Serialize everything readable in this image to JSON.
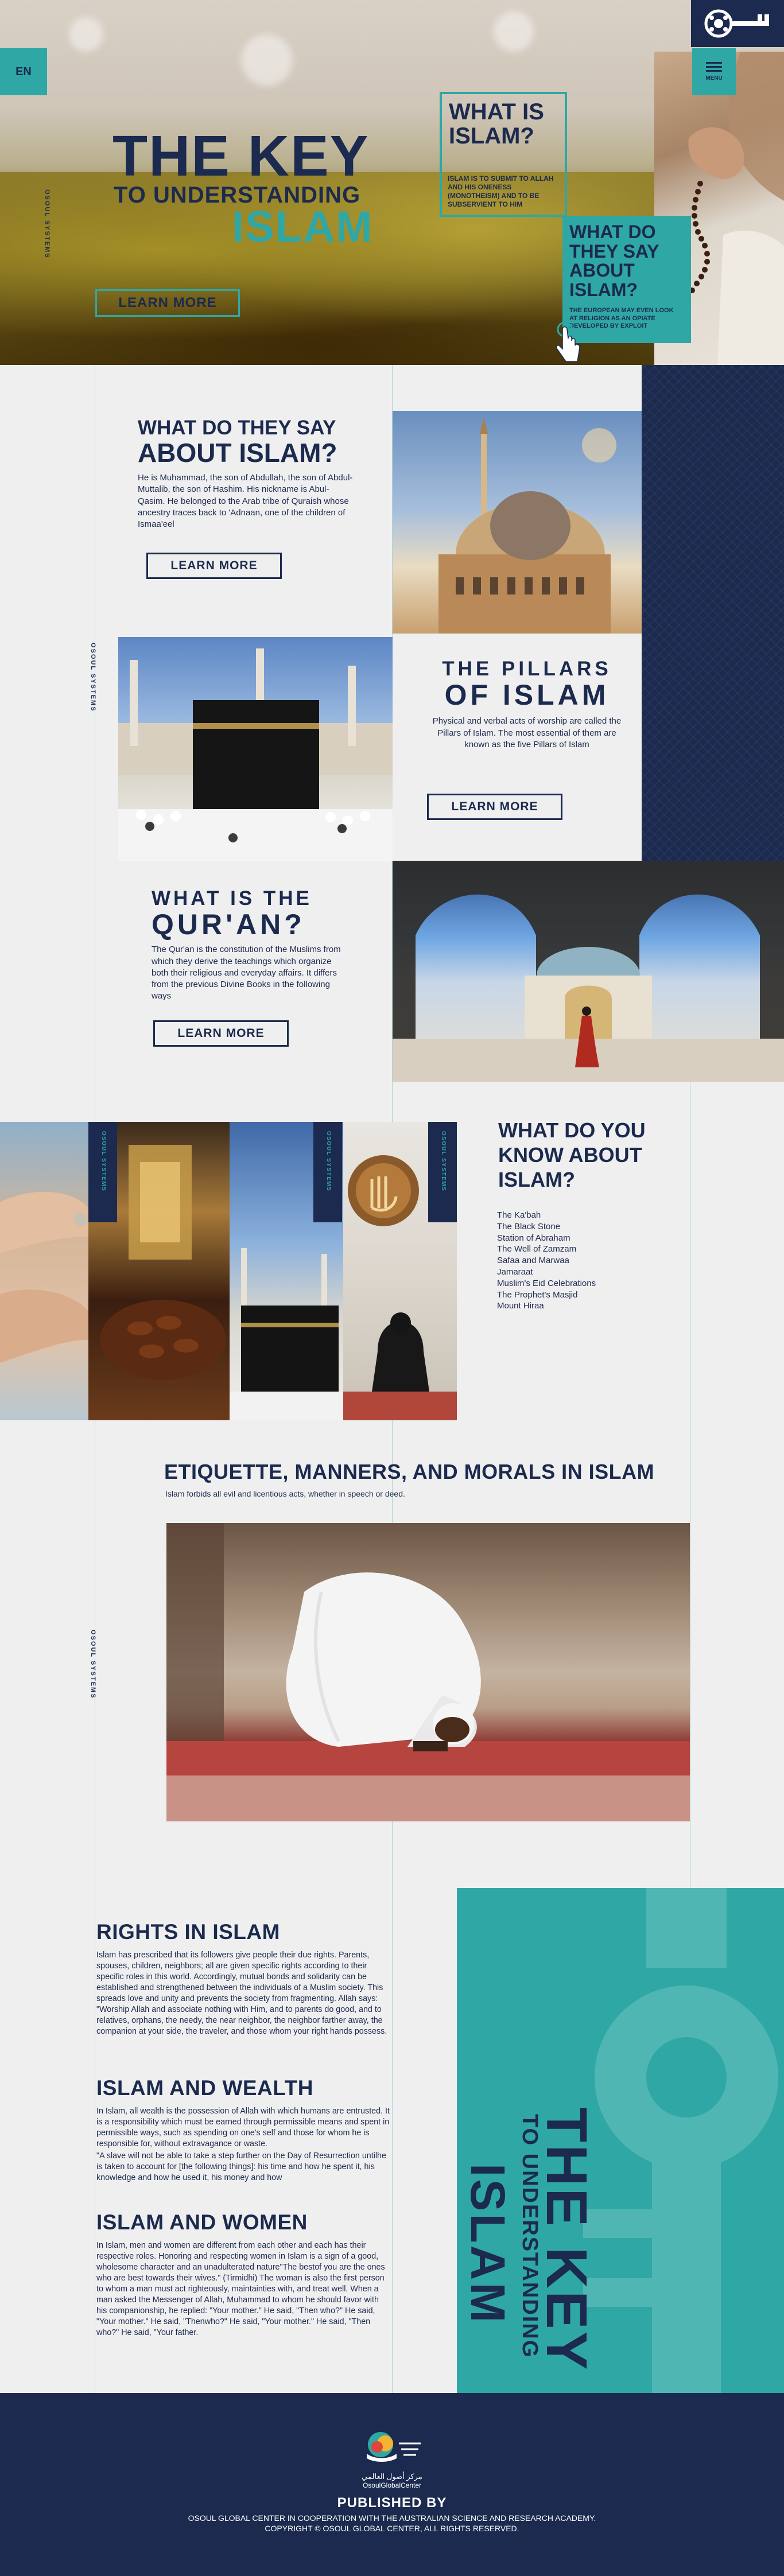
{
  "header": {
    "lang_label": "EN",
    "menu_label": "MENU",
    "side_label": "OSOUL SYSTEMS"
  },
  "hero": {
    "title_line1": "THE KEY",
    "title_line2": "TO UNDERSTANDING",
    "title_line3": "ISLAM",
    "learn_more": "LEARN MORE",
    "card1": {
      "title": "WHAT IS ISLAM?",
      "text": "ISLAM IS TO SUBMIT TO ALLAH AND HIS ONENESS (MONOTHEISM) AND TO BE SUBSERVIENT TO HIM"
    },
    "card2": {
      "title": "WHAT DO THEY SAY ABOUT ISLAM?",
      "text": "THE EUROPEAN MAY EVEN LOOK AT RELIGION AS AN OPIATE DEVELOPED BY EXPLOIT"
    }
  },
  "about": {
    "title_line1": "WHAT DO THEY SAY",
    "title_line2": "ABOUT ISLAM?",
    "text": "He is Muhammad, the son of Abdullah, the son of Abdul-Muttalib, the son of Hashim. His nickname is Abul-Qasim. He belonged to the Arab tribe of Quraish whose ancestry traces back to 'Adnaan, one of the children of Ismaa'eel",
    "learn_more": "LEARN MORE"
  },
  "pillars": {
    "title_line1": "THE PILLARS",
    "title_line2": "OF ISLAM",
    "text": "Physical and verbal acts of worship are called the Pillars of Islam. The most essential of them are known as the five Pillars of Islam",
    "learn_more": "LEARN MORE"
  },
  "quran": {
    "title_line1": "WHAT IS THE",
    "title_line2": "QUR'AN?",
    "text": "The Qur'an is the constitution of the Muslims from which they derive the teachings which organize both their religious and everyday affairs. It differs from the previous Divine Books in the following ways",
    "learn_more": "LEARN MORE"
  },
  "know": {
    "title": "WHAT DO YOU KNOW ABOUT ISLAM?",
    "items": [
      "The Ka'bah",
      "The Black Stone",
      "Station of Abraham",
      "The Well of Zamzam",
      "Safaa and Marwaa",
      "Jamaraat",
      "Muslim's Eid Celebrations",
      "The Prophet's Masjid",
      "Mount Hiraa"
    ],
    "strip_label": "OSOUL SYSTEMS"
  },
  "etiquette": {
    "title": "ETIQUETTE, MANNERS, AND MORALS IN ISLAM",
    "subtitle": "Islam forbids all evil and licentious acts, whether in speech or deed."
  },
  "rights": {
    "title": "RIGHTS IN ISLAM",
    "text": "Islam has prescribed that its followers give people their due rights. Parents, spouses, children, neighbors; all are given specific rights according to their specific roles in this world. Accordingly, mutual bonds and solidarity can be established and strengthened between the individuals of a Muslim society. This spreads love and unity and prevents the society from fragmenting. Allah says: \"Worship Allah and associate nothing with Him, and to parents do good, and to relatives, orphans, the needy, the near neighbor, the neighbor farther away, the companion at your side, the traveler, and those whom your right hands possess."
  },
  "wealth": {
    "title": "ISLAM AND WEALTH",
    "text1": "In Islam, all wealth is the possession of Allah with which humans are entrusted. It is a responsibility which must be earned through permissible means and spent in permissible ways, such as spending on one's self and those for whom he is responsible for, without extravagance or waste.",
    "text2": "\"A slave will not be able to take a step further on the Day of Resurrection untilhe is taken to account for [the following things]: his time and how he spent it, his knowledge and how he used it, his money and how"
  },
  "women": {
    "title": "ISLAM AND WOMEN",
    "text": "In Islam, men and women are different from each other and each has their respective roles. Honoring and respecting women in Islam is a sign of a good, wholesome character and an unadulterated nature\"The bestof you are the ones who are best towards their wives.\" (Tirmidhi) The woman is also the first person to whom a man must act righteously, maintainties with, and treat well. When a man asked the Messenger of Allah, Muhammad to whom he should favor with his companionship, he replied: \"Your mother.\" He said, \"Then who?\" He said, \"Your mother.\" He said, \"Thenwho?\" He said, \"Your mother.\" He said, \"Then who?\" He said, \"Your father."
  },
  "promo": {
    "line1": "THE KEY",
    "line2": "TO UNDERSTANDING",
    "line3": "ISLAM"
  },
  "footer": {
    "logo_arabic": "مركز أصول العالمي",
    "logo_latin": "OsoulGlobalCenter",
    "published_by": "PUBLISHED BY",
    "line1": "OSOUL GLOBAL CENTER IN COOPERATION WITH THE AUSTRALIAN SCIENCE AND RESEARCH ACADEMY.",
    "line2": "COPYRIGHT © OSOUL GLOBAL CENTER, ALL RIGHTS RESERVED."
  },
  "colors": {
    "navy": "#1b2a4e",
    "teal": "#2fa7a5",
    "background": "#efefef"
  },
  "icons": [
    "key-logo-icon",
    "hamburger-menu-icon",
    "pointer-hand-icon",
    "allah-calligraphy-icon"
  ]
}
